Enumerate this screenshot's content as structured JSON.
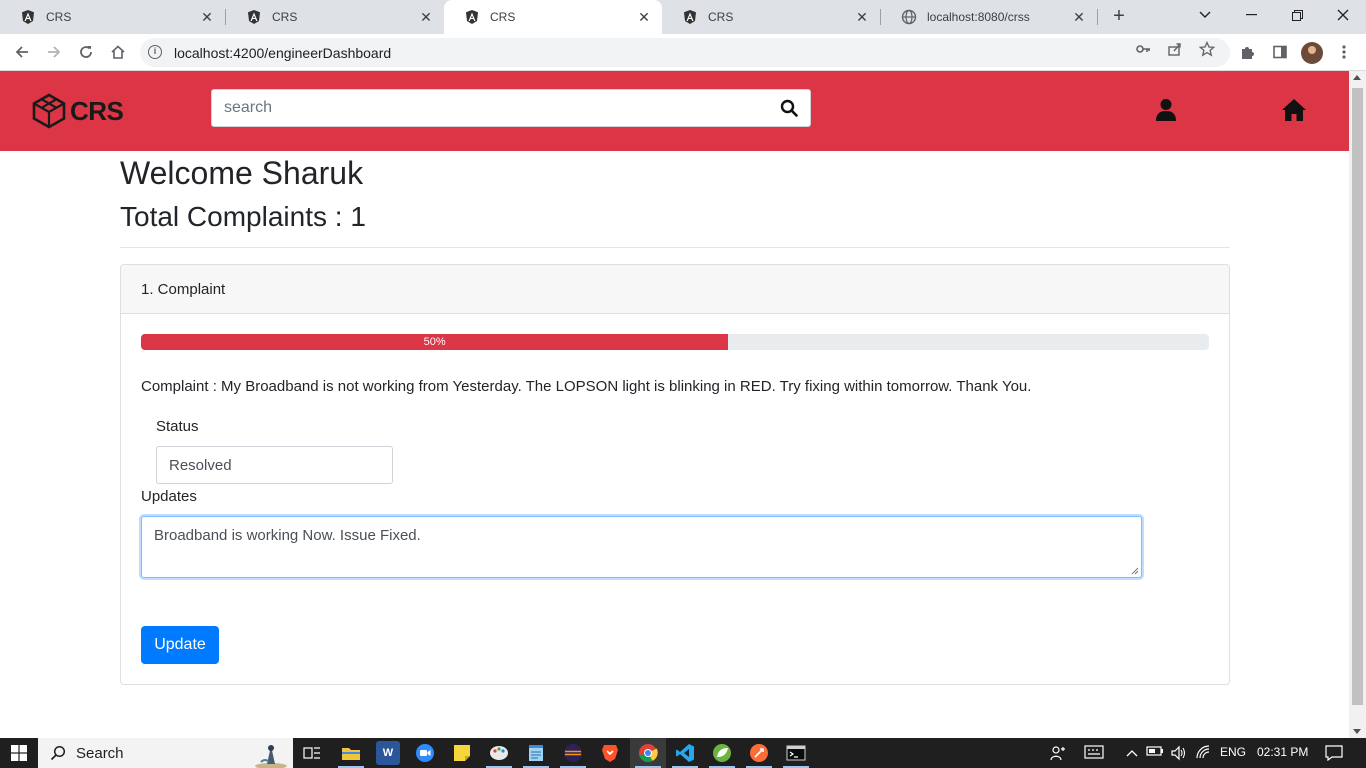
{
  "browser": {
    "tabs": [
      {
        "title": "CRS",
        "favicon": "angular-icon",
        "active": false
      },
      {
        "title": "CRS",
        "favicon": "angular-icon",
        "active": false
      },
      {
        "title": "CRS",
        "favicon": "angular-icon",
        "active": true
      },
      {
        "title": "CRS",
        "favicon": "angular-icon",
        "active": false
      },
      {
        "title": "localhost:8080/crss",
        "favicon": "globe-icon",
        "active": false
      }
    ],
    "url": "localhost:4200/engineerDashboard"
  },
  "app": {
    "brand": "CRS",
    "colors": {
      "navbar": "#dc3545",
      "primary": "#007bff",
      "progress": "#dc3545"
    },
    "search": {
      "placeholder": "search",
      "value": ""
    }
  },
  "dashboard": {
    "welcome": "Welcome Sharuk",
    "total_complaints": "Total Complaints : 1",
    "complaints": [
      {
        "header": "1. Complaint",
        "progress_percent": 55,
        "progress_label": "50%",
        "text": "Complaint : My Broadband is not working from Yesterday. The LOPSON light is blinking in RED. Try fixing within tomorrow. Thank You.",
        "status_label": "Status",
        "status_value": "Resolved",
        "updates_label": "Updates",
        "updates_value": "Broadband is working Now. Issue Fixed.",
        "button_label": "Update"
      }
    ]
  },
  "taskbar": {
    "search_label": "Search",
    "language": "ENG",
    "time": "02:31 PM"
  }
}
